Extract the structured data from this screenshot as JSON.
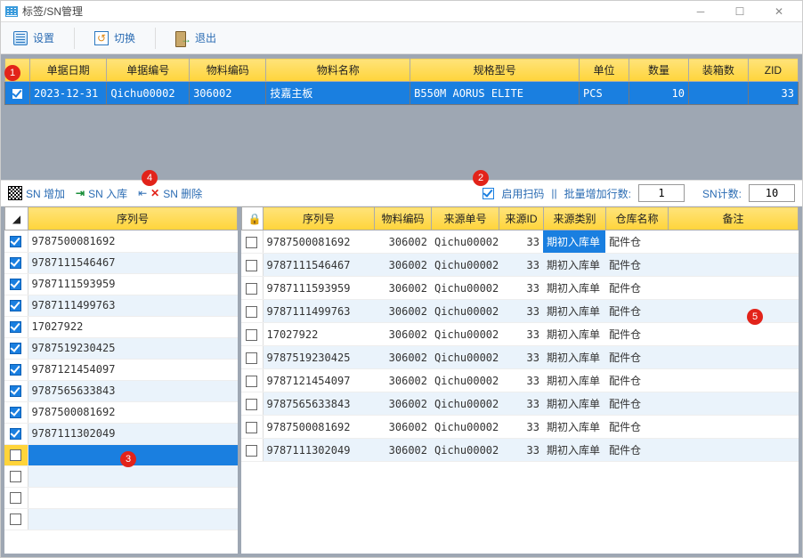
{
  "window": {
    "title": "标签/SN管理"
  },
  "toolbar": {
    "settings": "设置",
    "switch": "切换",
    "exit": "退出"
  },
  "badges": {
    "b1": "1",
    "b2": "2",
    "b3": "3",
    "b4": "4",
    "b5": "5"
  },
  "top_cols": {
    "c1": "单据日期",
    "c2": "单据编号",
    "c3": "物料编码",
    "c4": "物料名称",
    "c5": "规格型号",
    "c6": "单位",
    "c7": "数量",
    "c8": "装箱数",
    "c9": "ZID"
  },
  "top_row": {
    "date": "2023-12-31",
    "doc": "Qichu00002",
    "mat": "306002",
    "name": "技嘉主板",
    "spec": "B550M AORUS ELITE",
    "unit": "PCS",
    "qty": "10",
    "box": "",
    "zid": "33"
  },
  "mid": {
    "sn_add": "SN 增加",
    "sn_in": "SN 入库",
    "sn_del": "SN 删除",
    "enable_scan": "启用扫码",
    "pipe": "||",
    "batch_add": "批量增加行数:",
    "batch_val": "1",
    "sn_count": "SN计数:",
    "sn_count_val": "10"
  },
  "left": {
    "header": "序列号",
    "rows": [
      "9787500081692",
      "9787111546467",
      "9787111593959",
      "9787111499763",
      "17027922",
      "9787519230425",
      "9787121454097",
      "9787565633843",
      "9787500081692",
      "9787111302049"
    ]
  },
  "right": {
    "cols": {
      "c1": "序列号",
      "c2": "物料编码",
      "c3": "来源单号",
      "c4": "来源ID",
      "c5": "来源类别",
      "c6": "仓库名称",
      "c7": "备注"
    },
    "rows": [
      {
        "sn": "9787500081692",
        "mat": "306002",
        "src": "Qichu00002",
        "sid": "33",
        "type": "期初入库单",
        "wh": "配件仓",
        "note": ""
      },
      {
        "sn": "9787111546467",
        "mat": "306002",
        "src": "Qichu00002",
        "sid": "33",
        "type": "期初入库单",
        "wh": "配件仓",
        "note": ""
      },
      {
        "sn": "9787111593959",
        "mat": "306002",
        "src": "Qichu00002",
        "sid": "33",
        "type": "期初入库单",
        "wh": "配件仓",
        "note": ""
      },
      {
        "sn": "9787111499763",
        "mat": "306002",
        "src": "Qichu00002",
        "sid": "33",
        "type": "期初入库单",
        "wh": "配件仓",
        "note": ""
      },
      {
        "sn": "17027922",
        "mat": "306002",
        "src": "Qichu00002",
        "sid": "33",
        "type": "期初入库单",
        "wh": "配件仓",
        "note": ""
      },
      {
        "sn": "9787519230425",
        "mat": "306002",
        "src": "Qichu00002",
        "sid": "33",
        "type": "期初入库单",
        "wh": "配件仓",
        "note": ""
      },
      {
        "sn": "9787121454097",
        "mat": "306002",
        "src": "Qichu00002",
        "sid": "33",
        "type": "期初入库单",
        "wh": "配件仓",
        "note": ""
      },
      {
        "sn": "9787565633843",
        "mat": "306002",
        "src": "Qichu00002",
        "sid": "33",
        "type": "期初入库单",
        "wh": "配件仓",
        "note": ""
      },
      {
        "sn": "9787500081692",
        "mat": "306002",
        "src": "Qichu00002",
        "sid": "33",
        "type": "期初入库单",
        "wh": "配件仓",
        "note": ""
      },
      {
        "sn": "9787111302049",
        "mat": "306002",
        "src": "Qichu00002",
        "sid": "33",
        "type": "期初入库单",
        "wh": "配件仓",
        "note": ""
      }
    ]
  }
}
